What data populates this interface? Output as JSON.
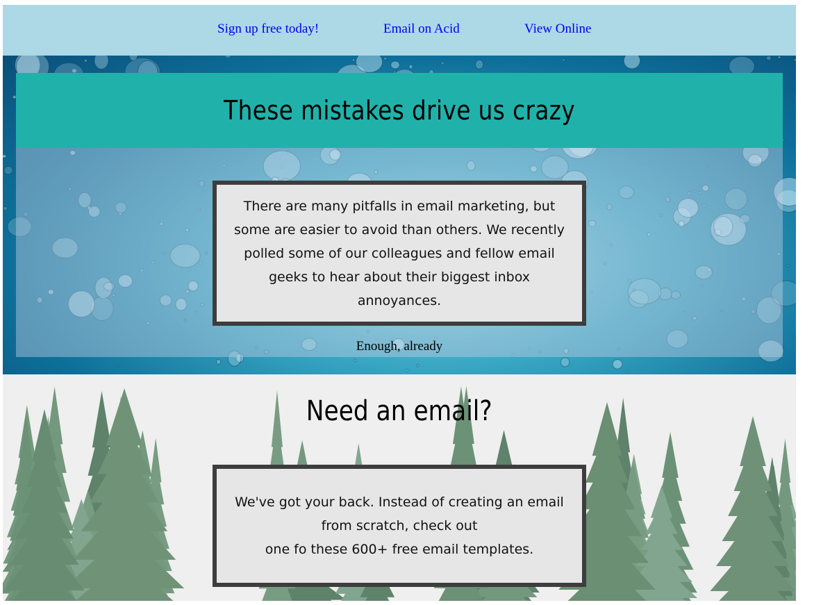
{
  "nav": {
    "links": [
      "Sign up free today!",
      "Email on Acid",
      "View Online"
    ]
  },
  "hero": {
    "title": "These mistakes drive us crazy",
    "body": "There are many pitfalls in email marketing, but some are easier to avoid than others. We recently polled some of our colleagues and fellow email geeks to hear about their biggest inbox annoyances.",
    "cta": "Enough, already"
  },
  "forest": {
    "title": "Need an email?",
    "body_line1": "We've got your back. Instead of creating an email from scratch, check out",
    "body_line2": "one fo these 600+ free email templates."
  },
  "colors": {
    "topbar": "#add8e6",
    "title_band": "#20b2aa",
    "card_bg": "#e6e6e6",
    "card_border": "#3d3d3d",
    "link": "#0000ee"
  }
}
